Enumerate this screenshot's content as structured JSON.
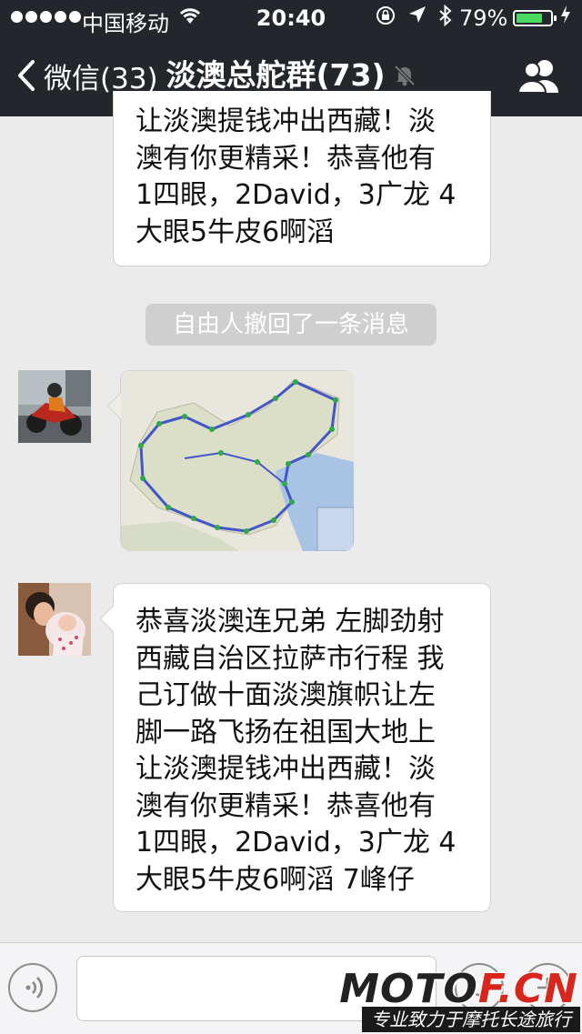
{
  "status_bar": {
    "carrier": "中国移动",
    "time": "20:40",
    "battery_percent": "79%",
    "battery_level": 0.79,
    "battery_color": "#4cd964"
  },
  "nav": {
    "back_label": "微信(33)",
    "title": "淡澳总舵群(73)",
    "icons": [
      "back-chevron-icon",
      "mute-bell-icon",
      "group-members-icon"
    ]
  },
  "messages": [
    {
      "type": "text",
      "text": "让淡澳提钱冲出西藏！淡\n澳有你更精采！恭喜他有\n1四眼，2David，3广龙  4\n大眼5牛皮6啊滔"
    },
    {
      "type": "system",
      "text": "自由人撤回了一条消息"
    },
    {
      "type": "image",
      "avatar": "motorcycle-rider-avatar",
      "content": "china-route-map"
    },
    {
      "type": "text",
      "avatar": "parent-with-baby-avatar",
      "text": "恭喜淡澳连兄弟 左脚劲射\n西藏自治区拉萨市行程 我\n己订做十面淡澳旗帜让左\n脚一路飞扬在祖国大地上\n让淡澳提钱冲出西藏！淡\n澳有你更精采！恭喜他有\n1四眼，2David，3广龙  4\n大眼5牛皮6啊滔 7峰仔"
    }
  ],
  "input_bar": {
    "text_value": "",
    "icons": [
      "voice-icon",
      "emoji-icon",
      "plus-icon"
    ]
  },
  "watermark": {
    "main_prefix": "MOTO",
    "main_suffix": "F.CN",
    "sub": "专业致力于摩托长途旅行"
  }
}
